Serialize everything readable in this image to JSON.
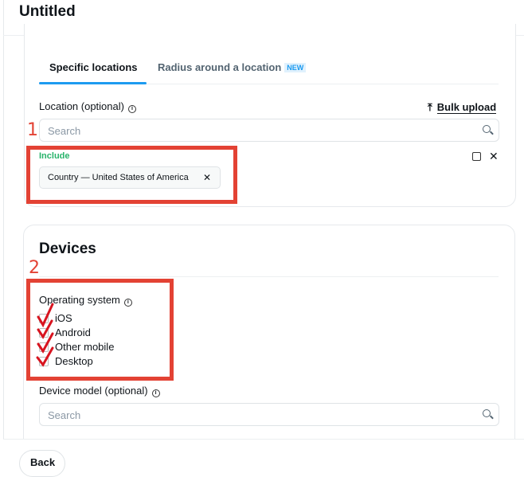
{
  "header": {
    "title": "Untitled"
  },
  "location": {
    "tabs": [
      {
        "label": "Specific locations",
        "active": true
      },
      {
        "label": "Radius around a location",
        "badge": "NEW"
      }
    ],
    "label": "Location (optional)",
    "bulk_upload": "Bulk upload",
    "search_placeholder": "Search",
    "include_label": "Include",
    "chips": [
      {
        "label": "Country — United States of America"
      }
    ],
    "annotation_number": "1"
  },
  "devices": {
    "title": "Devices",
    "os_label": "Operating system",
    "os_options": [
      {
        "label": "iOS",
        "checked": true
      },
      {
        "label": "Android",
        "checked": true
      },
      {
        "label": "Other mobile",
        "checked": true
      },
      {
        "label": "Desktop",
        "checked": true
      }
    ],
    "device_model_label": "Device model (optional)",
    "search_placeholder": "Search",
    "annotation_number": "2"
  },
  "footer": {
    "back": "Back"
  },
  "colors": {
    "accent": "#1d9bf0",
    "include": "#27b36a",
    "annotation": "#e34234"
  }
}
